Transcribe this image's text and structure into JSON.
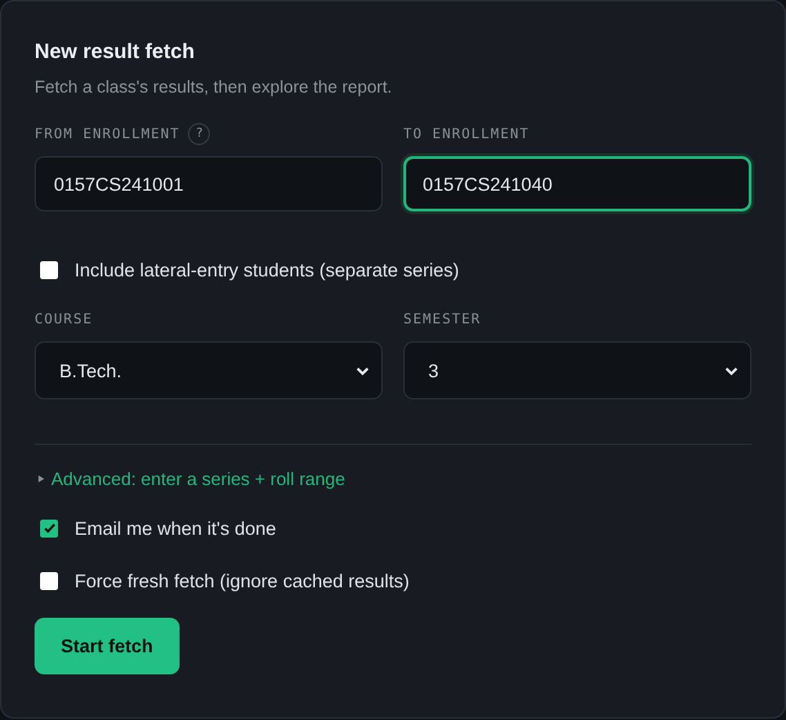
{
  "title": "New result fetch",
  "subtitle": "Fetch a class's results, then explore the report.",
  "range_fields": [
    {
      "label": "FROM ENROLLMENT",
      "help": "?",
      "value": "0157CS241001",
      "focused": false
    },
    {
      "label": "TO ENROLLMENT",
      "value": "0157CS241040",
      "focused": true
    }
  ],
  "lateral_entry": {
    "label": "Include lateral-entry students (separate series)",
    "checked": false
  },
  "selects": [
    {
      "label": "COURSE",
      "value": "B.Tech."
    },
    {
      "label": "SEMESTER",
      "value": "3"
    }
  ],
  "advanced": {
    "label": "Advanced: enter a series + roll range",
    "expanded": false
  },
  "options": [
    {
      "label": "Email me when it's done",
      "checked": true
    },
    {
      "label": "Force fresh fetch (ignore cached results)",
      "checked": false
    }
  ],
  "button": "Start fetch"
}
